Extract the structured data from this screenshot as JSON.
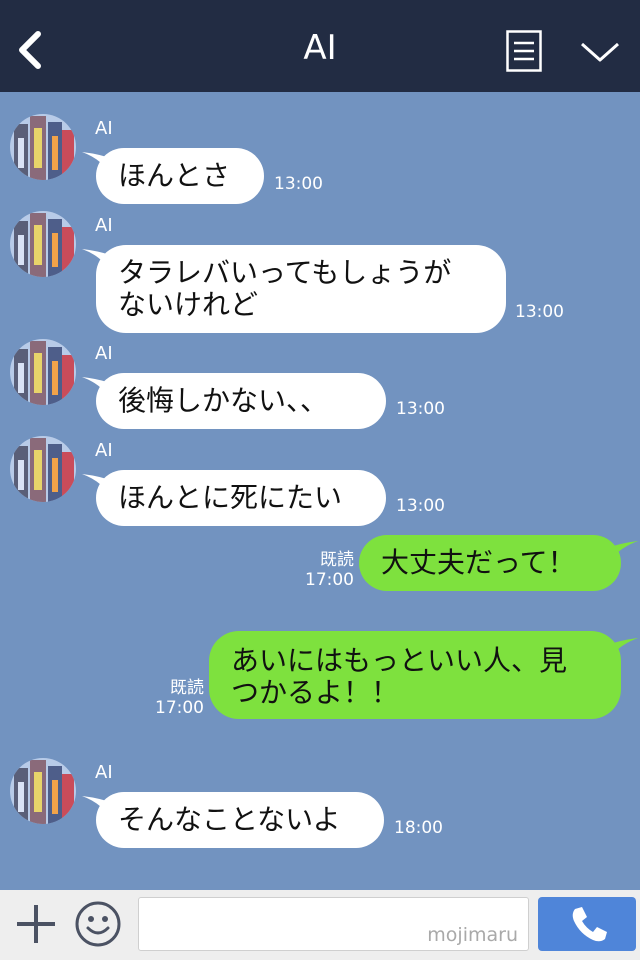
{
  "header": {
    "title": "AI"
  },
  "messages": [
    {
      "sender": "AI",
      "text": "ほんとさ",
      "time": "13:00"
    },
    {
      "sender": "AI",
      "text": "タラレバいってもしょうが\nないけれど",
      "time": "13:00"
    },
    {
      "sender": "AI",
      "text": "後悔しかない、、",
      "time": "13:00"
    },
    {
      "sender": "AI",
      "text": "ほんとに死にたい",
      "time": "13:00"
    },
    {
      "text": "大丈夫だって！",
      "read": "既読",
      "time": "17:00"
    },
    {
      "text": "あいにはもっといい人、見\nつかるよ！！",
      "read": "既読",
      "time": "17:00"
    },
    {
      "sender": "AI",
      "text": "そんなことないよ",
      "time": "18:00"
    }
  ],
  "footer": {
    "watermark": "mojimaru"
  },
  "colors": {
    "header_bg": "#222c43",
    "chat_bg": "#7293c0",
    "sent_bubble": "#7ee13e",
    "call_button": "#4f85d9"
  },
  "icons": {
    "back": "chevron-left-icon",
    "menu": "menu-icon",
    "collapse": "chevron-down-icon",
    "plus": "plus-icon",
    "emoji": "smiley-icon",
    "call": "phone-icon"
  }
}
